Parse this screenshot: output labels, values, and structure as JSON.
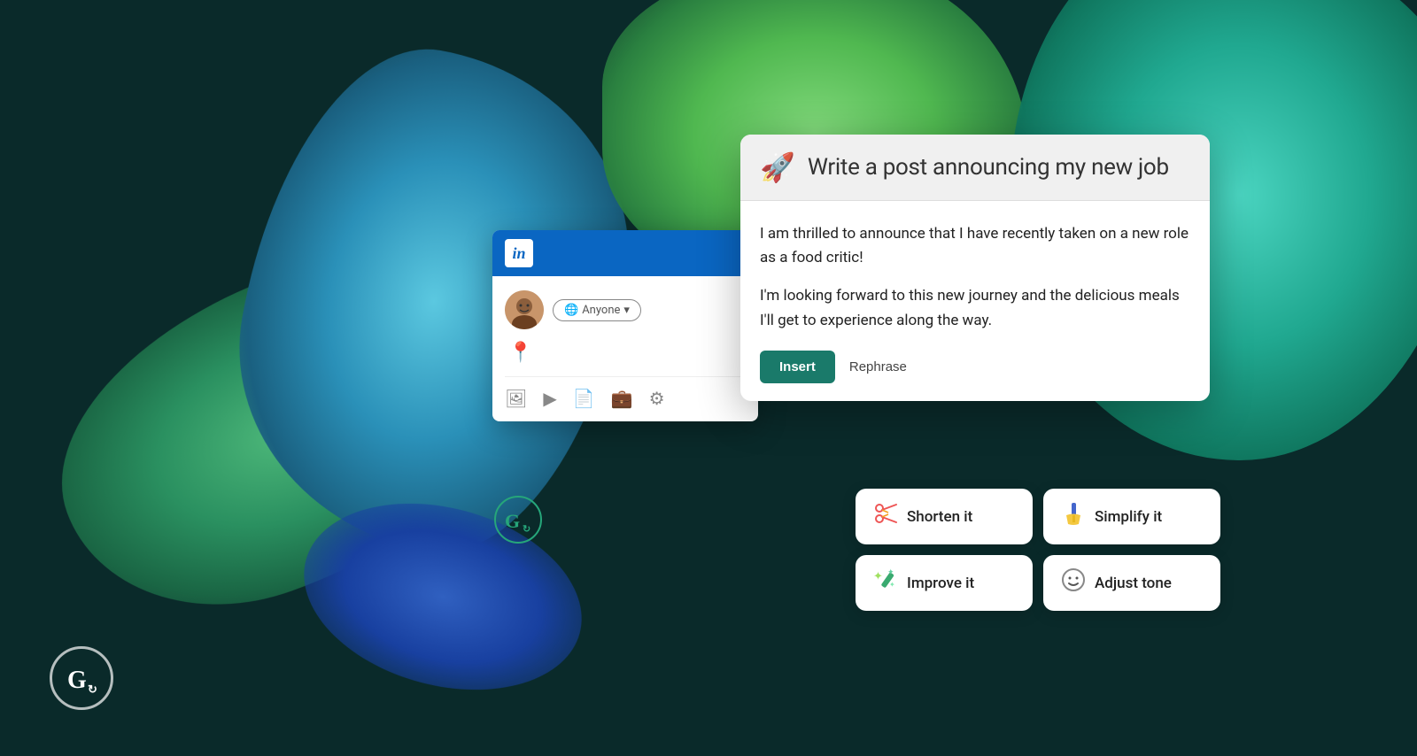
{
  "background": {
    "color": "#0a2a2a"
  },
  "grammarly_logo_bottom": {
    "aria_label": "Grammarly logo",
    "letter": "G"
  },
  "grammarly_circle": {
    "aria_label": "Grammarly circle icon",
    "letter": "G"
  },
  "linkedin_card": {
    "logo_text": "in",
    "audience_label": "Anyone",
    "audience_dropdown": "▾"
  },
  "ai_panel": {
    "header": {
      "icon": "🚀",
      "title": "Write a post announcing my new job"
    },
    "response": {
      "paragraph1": "I am thrilled to announce that I have recently taken on a new role as a food critic!",
      "paragraph2": "I'm looking forward to this new journey and the delicious meals I'll get to experience along the way."
    },
    "actions": {
      "insert_label": "Insert",
      "rephrase_label": "Rephrase"
    }
  },
  "suggestion_chips": [
    {
      "id": "shorten",
      "icon": "✂️",
      "icon_img": "scissors",
      "label": "Shorten it"
    },
    {
      "id": "simplify",
      "icon": "🪣",
      "icon_img": "broom",
      "label": "Simplify it"
    },
    {
      "id": "improve",
      "icon": "✨",
      "icon_img": "sparkles",
      "label": "Improve it"
    },
    {
      "id": "tone",
      "icon": "😊",
      "icon_img": "smiley",
      "label": "Adjust tone"
    }
  ]
}
